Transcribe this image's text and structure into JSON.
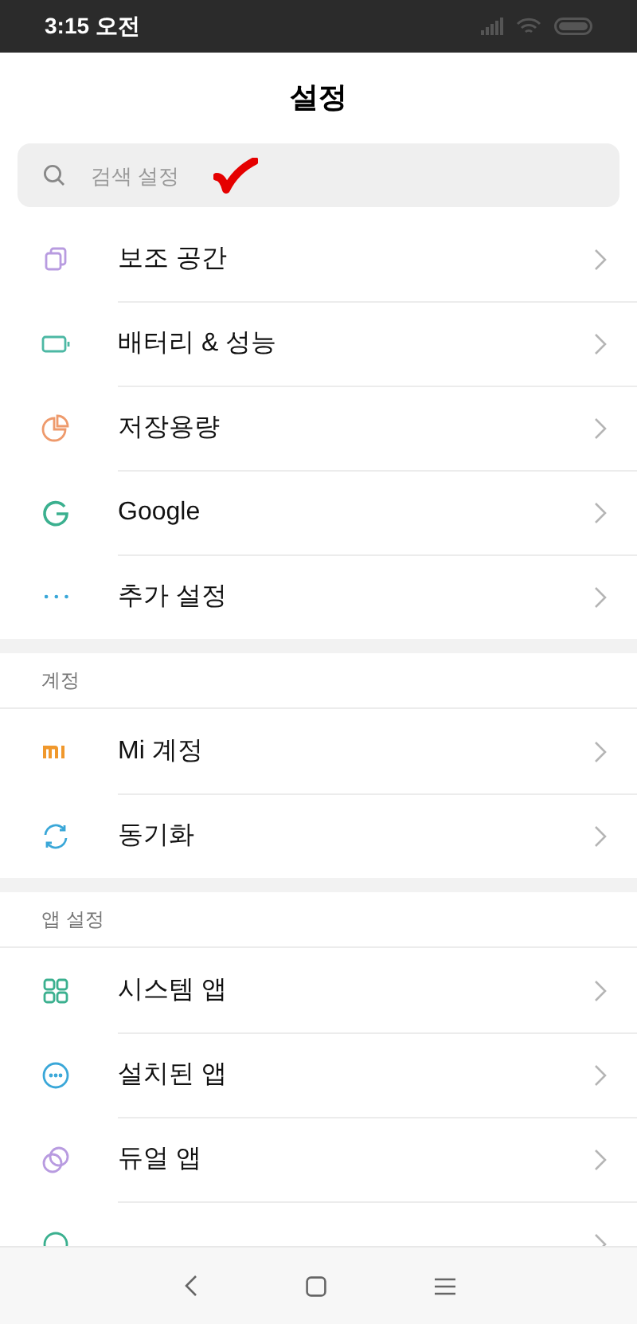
{
  "status_bar": {
    "time": "3:15 오전"
  },
  "title": "설정",
  "search": {
    "placeholder": "검색 설정",
    "annotated": true
  },
  "sections": [
    {
      "items": [
        {
          "label": "보조 공간",
          "kind": "copy"
        },
        {
          "label": "배터리 & 성능",
          "kind": "battery"
        },
        {
          "label": "저장용량",
          "kind": "pie"
        },
        {
          "label": "Google",
          "kind": "google"
        },
        {
          "label": "추가 설정",
          "kind": "dots"
        }
      ]
    },
    {
      "header": "계정",
      "items": [
        {
          "label": "Mi 계정",
          "kind": "mi"
        },
        {
          "label": "동기화",
          "kind": "sync"
        }
      ]
    },
    {
      "header": "앱 설정",
      "items": [
        {
          "label": "시스템 앱",
          "kind": "grid"
        },
        {
          "label": "설치된 앱",
          "kind": "circle-dots"
        },
        {
          "label": "듀얼 앱",
          "kind": "dual"
        },
        {
          "kind": "ring"
        }
      ]
    }
  ]
}
